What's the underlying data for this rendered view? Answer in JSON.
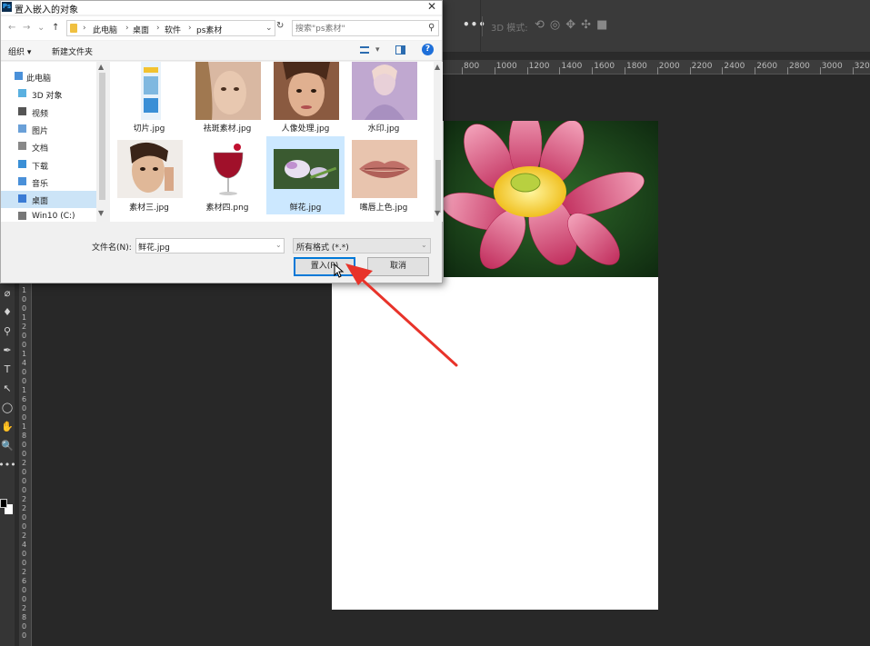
{
  "dialog": {
    "title": "置入嵌入的对象",
    "app_icon": "Ps",
    "close": "✕",
    "nav_buttons": [
      "←",
      "→",
      "⌄",
      "↑"
    ],
    "breadcrumb": [
      "此电脑",
      "桌面",
      "软件",
      "ps素材"
    ],
    "search_placeholder": "搜索\"ps素材\"",
    "commands": {
      "organize": "组织 ▾",
      "new_folder": "新建文件夹",
      "help": "?"
    },
    "nav_items": [
      {
        "label": "此电脑",
        "icon": "computer-icon",
        "color": "#4a90d9"
      },
      {
        "label": "3D 对象",
        "icon": "3d-objects-icon",
        "color": "#5ab0e0"
      },
      {
        "label": "视频",
        "icon": "video-icon",
        "color": "#555555"
      },
      {
        "label": "图片",
        "icon": "pictures-icon",
        "color": "#6aa0d8"
      },
      {
        "label": "文档",
        "icon": "documents-icon",
        "color": "#888888"
      },
      {
        "label": "下载",
        "icon": "downloads-icon",
        "color": "#3a8fd6"
      },
      {
        "label": "音乐",
        "icon": "music-icon",
        "color": "#4a90d9"
      },
      {
        "label": "桌面",
        "icon": "desktop-icon",
        "color": "#3a7bd5",
        "selected": true
      },
      {
        "label": "Win10 (C:)",
        "icon": "drive-icon",
        "color": "#777777"
      }
    ],
    "files": [
      {
        "name": "切片.jpg",
        "thumb": "slice-thumbnail"
      },
      {
        "name": "祛斑素材.jpg",
        "thumb": "freckle-face-thumbnail"
      },
      {
        "name": "人像处理.jpg",
        "thumb": "portrait-thumbnail"
      },
      {
        "name": "水印.jpg",
        "thumb": "watermark-thumbnail"
      },
      {
        "name": "素材三.jpg",
        "thumb": "model-face-thumbnail"
      },
      {
        "name": "素材四.png",
        "thumb": "wine-glass-thumbnail"
      },
      {
        "name": "鲜花.jpg",
        "thumb": "flower-thumbnail",
        "selected": true
      },
      {
        "name": "嘴唇上色.jpg",
        "thumb": "lips-thumbnail"
      }
    ],
    "filename_label": "文件名(N):",
    "filename_value": "鲜花.jpg",
    "filetype_value": "所有格式 (*.*)",
    "place_button": "置入(P)",
    "cancel_button": "取消"
  },
  "photoshop": {
    "more_button": "•••",
    "mode_3d_label": "3D 模式:",
    "ruler_ticks": [
      "800",
      "1000",
      "1200",
      "1400",
      "1600",
      "1800",
      "2000",
      "2200",
      "2400",
      "2600",
      "2800",
      "3000",
      "3200"
    ],
    "left_ruler_ticks": [
      "1",
      "0",
      "0",
      "1",
      "2",
      "0",
      "0",
      "1",
      "4",
      "0",
      "0",
      "1",
      "6",
      "0",
      "0",
      "1",
      "8",
      "0",
      "0",
      "2",
      "0",
      "0",
      "0",
      "2",
      "2",
      "0",
      "0",
      "2",
      "4",
      "0",
      "0",
      "2",
      "6",
      "0",
      "0",
      "2",
      "8",
      "0",
      "0"
    ],
    "tools": [
      "⌀",
      "♦",
      "⚲",
      "✒",
      "T",
      "↖",
      "◯",
      "✋",
      "🔍",
      "•••"
    ]
  },
  "colors": {
    "accent": "#0078d7",
    "selection": "#cce8ff",
    "annotation_arrow": "#e8332a"
  }
}
